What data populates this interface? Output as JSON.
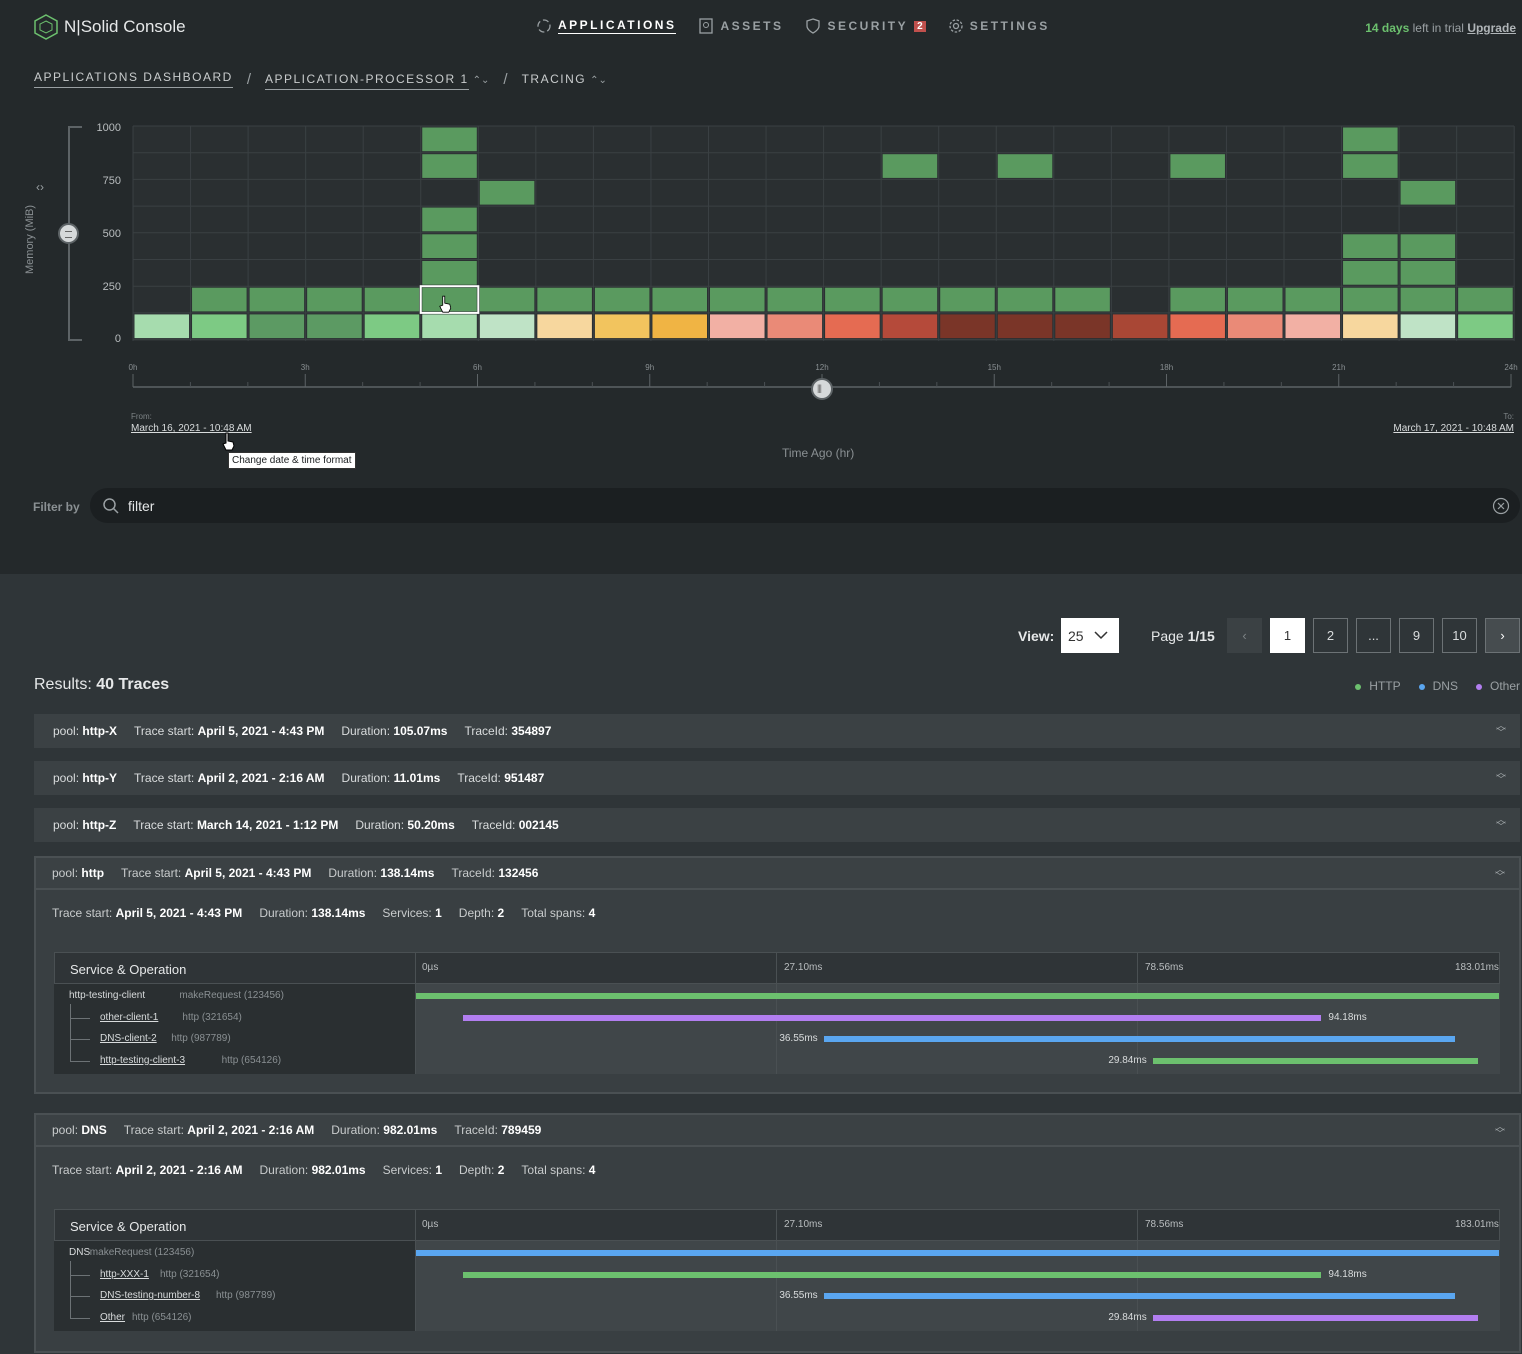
{
  "app": {
    "title": "N|Solid Console"
  },
  "nav": [
    {
      "label": "APPLICATIONS",
      "icon": "applications-icon",
      "active": true
    },
    {
      "label": "ASSETS",
      "icon": "assets-icon",
      "active": false
    },
    {
      "label": "SECURITY",
      "icon": "security-shield-icon",
      "active": false,
      "badge": "2"
    },
    {
      "label": "SETTINGS",
      "icon": "gear-icon",
      "active": false
    }
  ],
  "trial": {
    "days": "14 days",
    "text": " left in trial ",
    "upgrade": "Upgrade"
  },
  "breadcrumb": {
    "dashboard": "APPLICATIONS DASHBOARD",
    "app": "APPLICATION-PROCESSOR 1",
    "section": "TRACING"
  },
  "chart": {
    "ylabel": "Memory (MiB)",
    "yticks": [
      "1000",
      "750",
      "500",
      "250",
      "0"
    ],
    "xticks": [
      "0h",
      "3h",
      "6h",
      "9h",
      "12h",
      "15h",
      "18h",
      "21h",
      "24h"
    ],
    "from_label": "From:",
    "from_value": "March 16, 2021 - 10:48 AM",
    "to_label": "To:",
    "to_value": "March 17, 2021 - 10:48 AM",
    "xtitle": "Time Ago (hr)",
    "tooltip": "Change date & time format"
  },
  "chart_data": {
    "type": "heatmap",
    "ylabel": "Memory (MiB)",
    "xlabel": "Time Ago (hr)",
    "xlim": [
      0,
      24
    ],
    "ylim": [
      0,
      1000
    ],
    "columns": 24,
    "bottom_row_colors": [
      "#a6dcae",
      "#7dca84",
      "#5c9a63",
      "#5c9a63",
      "#7dca84",
      "#a6dcae",
      "#bfe3c6",
      "#f7d79e",
      "#f2c45e",
      "#f0b444",
      "#f2b0a4",
      "#ea8a77",
      "#e56b52",
      "#b54a3a",
      "#7a3528",
      "#7a3528",
      "#7a3528",
      "#a94735",
      "#e56b52",
      "#ea8a77",
      "#f2b0a4",
      "#f7d79e",
      "#bfe3c6",
      "#7dca84"
    ],
    "cells": [
      {
        "col": 1,
        "row": 1
      },
      {
        "col": 2,
        "row": 1
      },
      {
        "col": 3,
        "row": 1
      },
      {
        "col": 4,
        "row": 1
      },
      {
        "col": 5,
        "row": 1
      },
      {
        "col": 5,
        "row": 2
      },
      {
        "col": 5,
        "row": 3
      },
      {
        "col": 5,
        "row": 4
      },
      {
        "col": 5,
        "row": 6
      },
      {
        "col": 5,
        "row": 7
      },
      {
        "col": 6,
        "row": 1
      },
      {
        "col": 6,
        "row": 5
      },
      {
        "col": 7,
        "row": 1
      },
      {
        "col": 8,
        "row": 1
      },
      {
        "col": 9,
        "row": 1
      },
      {
        "col": 10,
        "row": 1
      },
      {
        "col": 11,
        "row": 1
      },
      {
        "col": 12,
        "row": 1
      },
      {
        "col": 13,
        "row": 1
      },
      {
        "col": 13,
        "row": 6
      },
      {
        "col": 14,
        "row": 1
      },
      {
        "col": 15,
        "row": 1
      },
      {
        "col": 15,
        "row": 6
      },
      {
        "col": 16,
        "row": 1
      },
      {
        "col": 18,
        "row": 1
      },
      {
        "col": 18,
        "row": 6
      },
      {
        "col": 19,
        "row": 1
      },
      {
        "col": 20,
        "row": 1
      },
      {
        "col": 21,
        "row": 1
      },
      {
        "col": 21,
        "row": 2
      },
      {
        "col": 21,
        "row": 3
      },
      {
        "col": 21,
        "row": 6
      },
      {
        "col": 21,
        "row": 7
      },
      {
        "col": 22,
        "row": 1
      },
      {
        "col": 22,
        "row": 2
      },
      {
        "col": 22,
        "row": 3
      },
      {
        "col": 22,
        "row": 5
      },
      {
        "col": 23,
        "row": 1
      }
    ],
    "selected": {
      "col": 5,
      "row": 1
    }
  },
  "filter": {
    "label": "Filter by",
    "placeholder": "filter"
  },
  "pagination": {
    "view_label": "View:",
    "view_value": "25",
    "page_label": "Page",
    "page_value": "1/15",
    "pages": [
      "1",
      "2",
      "...",
      "9",
      "10"
    ]
  },
  "results": {
    "label": "Results:",
    "value": "40 Traces"
  },
  "legend": [
    {
      "label": "HTTP",
      "color": "#6cc06e"
    },
    {
      "label": "DNS",
      "color": "#5aa6f0"
    },
    {
      "label": "Other",
      "color": "#b27ef0"
    }
  ],
  "labels": {
    "pool": "pool:",
    "trace_start": "Trace start:",
    "duration": "Duration:",
    "trace_id": "TraceId:",
    "services": "Services:",
    "depth": "Depth:",
    "total_spans": "Total spans:",
    "service_op": "Service & Operation"
  },
  "traces": [
    {
      "pool": "http-X",
      "start": "April 5, 2021 - 4:43 PM",
      "duration": "105.07ms",
      "id": "354897"
    },
    {
      "pool": "http-Y",
      "start": "April 2, 2021 - 2:16 AM",
      "duration": "11.01ms",
      "id": "951487"
    },
    {
      "pool": "http-Z",
      "start": "March 14, 2021 - 1:12 PM",
      "duration": "50.20ms",
      "id": "002145"
    }
  ],
  "expanded": [
    {
      "pool": "http",
      "start": "April 5, 2021 - 4:43 PM",
      "duration": "138.14ms",
      "id": "132456",
      "services": "1",
      "depth": "2",
      "spans": "4",
      "ticks": [
        "0µs",
        "27.10ms",
        "78.56ms",
        "183.01ms"
      ],
      "rows": [
        {
          "svc": "http-testing-client",
          "op": "makeRequest (123456)",
          "link": false,
          "color": "#6cc06e",
          "start_ms": 0,
          "end_ms": 183.01,
          "label": ""
        },
        {
          "svc": "other-client-1",
          "op": "http (321654)",
          "link": true,
          "color": "#b27ef0",
          "start_ms": 8,
          "end_ms": 153,
          "label": "94.18ms",
          "label_side": "right"
        },
        {
          "svc": "DNS-client-2",
          "op": "http (987789)",
          "link": true,
          "color": "#5aa6f0",
          "start_ms": 69,
          "end_ms": 175.5,
          "label": "36.55ms",
          "label_side": "left"
        },
        {
          "svc": "http-testing-client-3",
          "op": "http (654126)",
          "link": true,
          "color": "#6cc06e",
          "start_ms": 124.6,
          "end_ms": 179.5,
          "label": "29.84ms",
          "label_side": "left"
        }
      ]
    },
    {
      "pool": "DNS",
      "start": "April 2, 2021 - 2:16 AM",
      "duration": "982.01ms",
      "id": "789459",
      "services": "1",
      "depth": "2",
      "spans": "4",
      "ticks": [
        "0µs",
        "27.10ms",
        "78.56ms",
        "183.01ms"
      ],
      "rows": [
        {
          "svc": "DNS",
          "op": "makeRequest (123456)",
          "link": false,
          "color": "#5aa6f0",
          "start_ms": 0,
          "end_ms": 183.01,
          "label": ""
        },
        {
          "svc": "http-XXX-1",
          "op": "http (321654)",
          "link": true,
          "color": "#6cc06e",
          "start_ms": 8,
          "end_ms": 153,
          "label": "94.18ms",
          "label_side": "right"
        },
        {
          "svc": "DNS-testing-number-8",
          "op": "http (987789)",
          "link": true,
          "color": "#5aa6f0",
          "start_ms": 69,
          "end_ms": 175.5,
          "label": "36.55ms",
          "label_side": "left"
        },
        {
          "svc": "Other",
          "op": "http (654126)",
          "link": true,
          "color": "#b27ef0",
          "start_ms": 124.6,
          "end_ms": 179.5,
          "label": "29.84ms",
          "label_side": "left"
        }
      ]
    }
  ]
}
